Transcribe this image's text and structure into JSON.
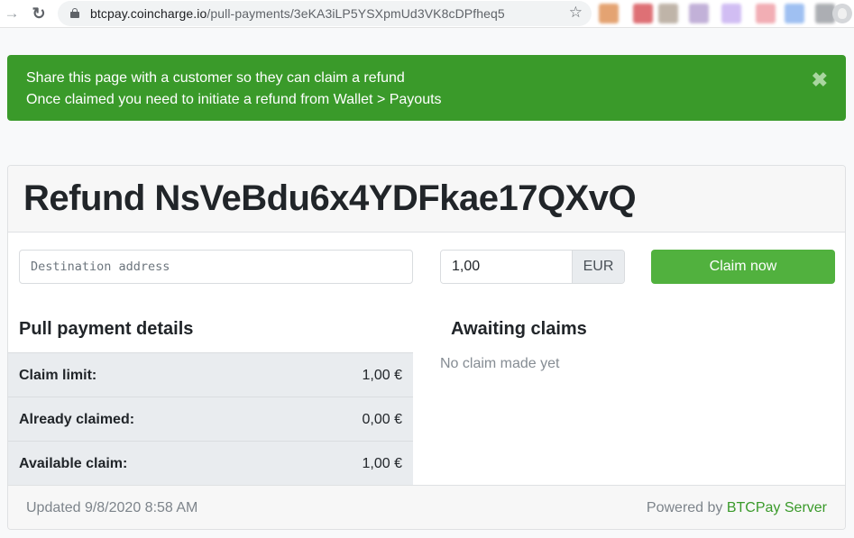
{
  "browser": {
    "url_host": "btcpay.coincharge.io",
    "url_path": "/pull-payments/3eKA3iLP5YSXpmUd3VK8cDPfheq5",
    "nav_forward_icon": "→",
    "nav_reload_icon": "↻",
    "bookmark_icon": "☆",
    "extension_colors": [
      "#e0945a",
      "#d9585e",
      "#b5a89a",
      "#b8a4d2",
      "#c9b2f2",
      "#f0a0a8",
      "#8fb6f0",
      "#9ea1a6"
    ]
  },
  "alert": {
    "line1": "Share this page with a customer so they can claim a refund",
    "line2": "Once claimed you need to initiate a refund from Wallet > Payouts",
    "close_icon": "✖",
    "color": "#3a9a2a"
  },
  "card": {
    "title": "Refund NsVeBdu6x4YDFkae17QXvQ",
    "destination_placeholder": "Destination address",
    "destination_value": "",
    "amount_value": "1,00",
    "currency": "EUR",
    "claim_button": "Claim now",
    "claim_button_color": "#51b13e"
  },
  "details": {
    "title": "Pull payment details",
    "rows": [
      {
        "label": "Claim limit:",
        "value": "1,00 €"
      },
      {
        "label": "Already claimed:",
        "value": "0,00 €"
      },
      {
        "label": "Available claim:",
        "value": "1,00 €"
      }
    ]
  },
  "awaiting": {
    "title": "Awaiting claims",
    "empty_text": "No claim made yet"
  },
  "footer": {
    "updated": "Updated 9/8/2020 8:58 AM",
    "powered_prefix": "Powered by ",
    "powered_link": "BTCPay Server"
  }
}
